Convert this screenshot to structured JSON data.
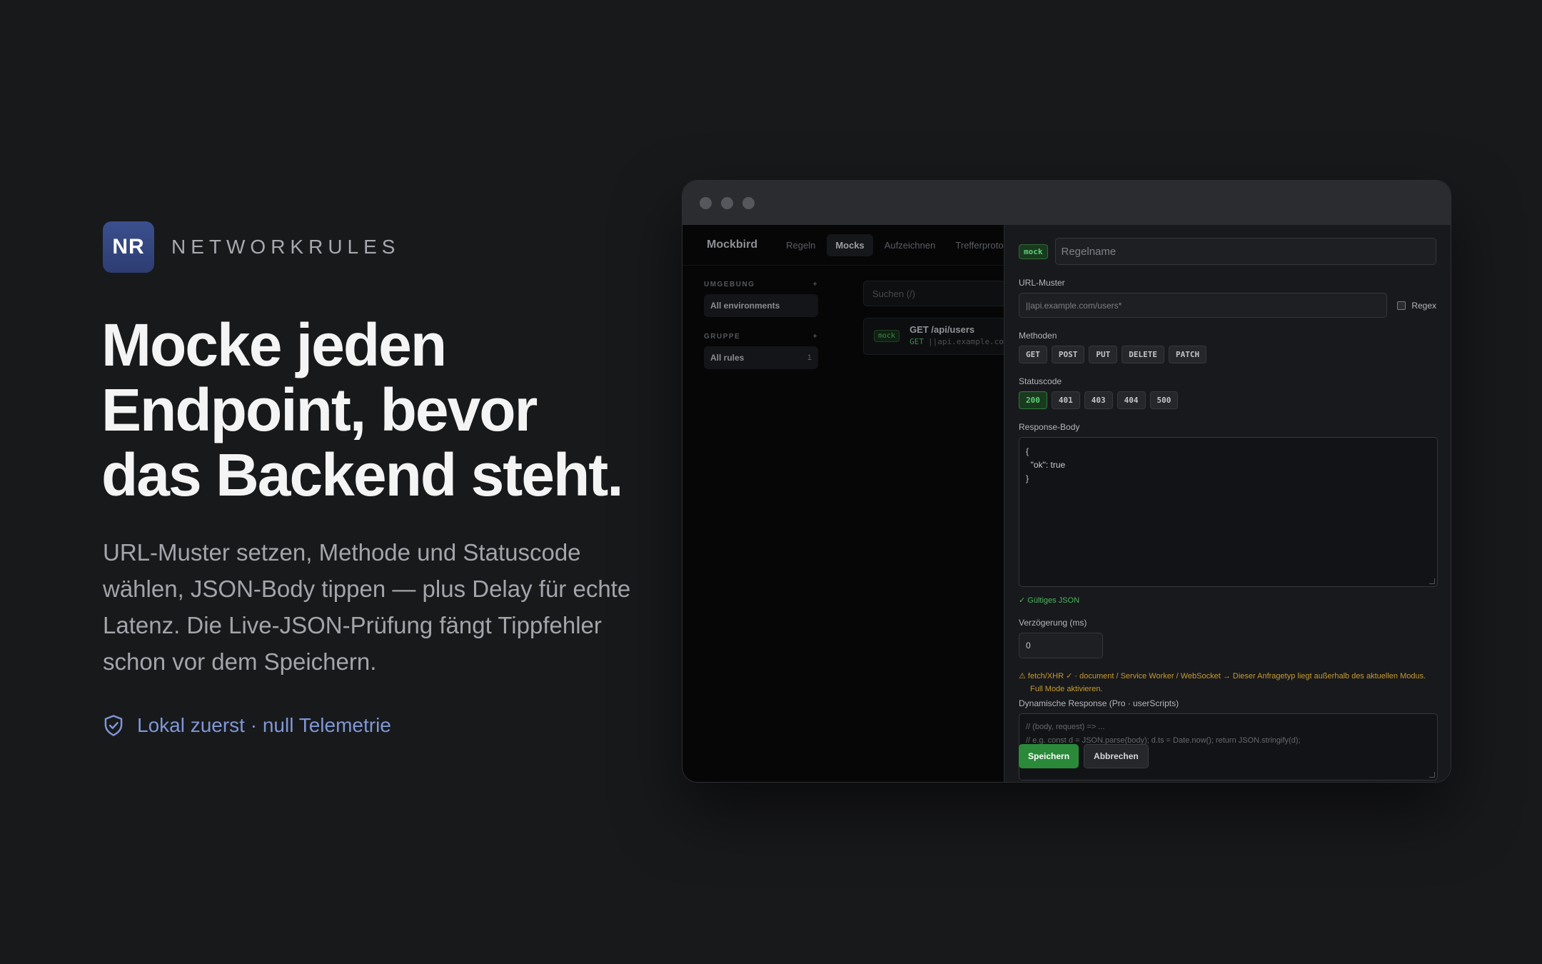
{
  "brand": {
    "logo_text": "NR",
    "name": "NETWORKRULES",
    "accent": "#3b4f8e"
  },
  "hero": {
    "headline": [
      "Mocke jeden",
      "Endpoint, bevor",
      "das Backend steht."
    ],
    "subtext": "URL-Muster setzen, Methode und Statuscode wählen, JSON-Body tippen — plus Delay für echte Latenz. Die Live-JSON-Prüfung fängt Tippfehler schon vor dem Speichern.",
    "tagline": "Lokal zuerst · null Telemetrie",
    "tagline_icon": "shield-check-icon"
  },
  "app": {
    "name": "Mockbird",
    "tabs": [
      "Regeln",
      "Mocks",
      "Aufzeichnen",
      "Trefferprotokoll"
    ],
    "active_tab": "Mocks",
    "sidebar": {
      "env_header": "UMGEBUNG",
      "env_item": "All environments",
      "group_header": "GRUPPE",
      "group_item": "All rules",
      "group_count": "1",
      "add_symbol": "+"
    },
    "search_placeholder": "Suchen  (/)",
    "rule": {
      "badge": "mock",
      "title": "GET /api/users",
      "method": "GET",
      "pattern": "||api.example.com/users*"
    }
  },
  "editor": {
    "badge": "mock",
    "name_placeholder": "Regelname",
    "url_label": "URL-Muster",
    "url_value": "||api.example.com/users*",
    "regex_label": "Regex",
    "methods_label": "Methoden",
    "methods": [
      "GET",
      "POST",
      "PUT",
      "DELETE",
      "PATCH"
    ],
    "status_label": "Statuscode",
    "status_codes": [
      "200",
      "401",
      "403",
      "404",
      "500"
    ],
    "selected_status": "200",
    "body_label": "Response-Body",
    "body_value": "{\n  \"ok\": true\n}",
    "valid_text": "✓ Gültiges JSON",
    "delay_label": "Verzögerung (ms)",
    "delay_value": "0",
    "warning": "⚠ fetch/XHR ✓ · document / Service Worker / WebSocket → Dieser Anfragetyp liegt außerhalb des aktuellen Modus. Full Mode aktivieren.",
    "dynamic_label": "Dynamische Response (Pro · userScripts)",
    "dynamic_line1": "// (body, request) => ...",
    "dynamic_line2": "// e.g. const d = JSON.parse(body); d.ts = Date.now(); return JSON.stringify(d);",
    "save_label": "Speichern",
    "cancel_label": "Abbrechen"
  },
  "colors": {
    "background": "#18191b",
    "success": "#2a8a3a",
    "warning": "#c79a2f",
    "link": "#7f97d6"
  }
}
